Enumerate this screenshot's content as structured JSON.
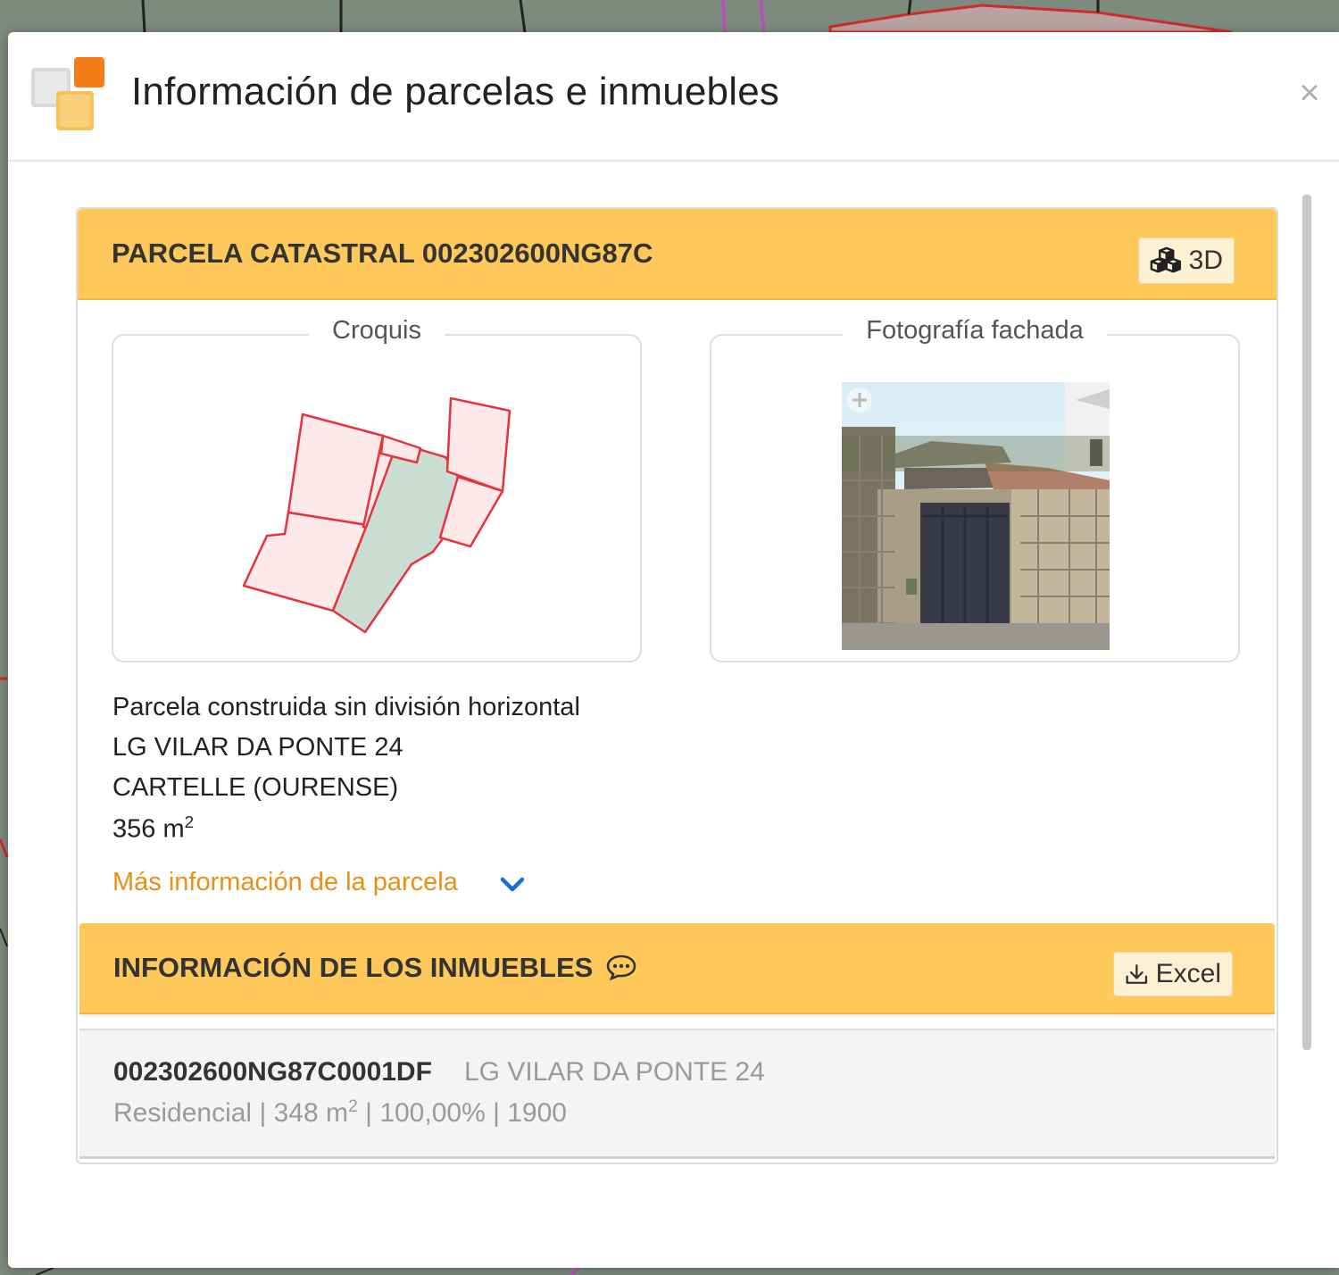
{
  "modal": {
    "title": "Información de parcelas e inmuebles",
    "close_label": "×"
  },
  "parcel": {
    "heading": "PARCELA CATASTRAL 002302600NG87C",
    "btn_3d_label": "3D",
    "sketch_legend": "Croquis",
    "photo_legend": "Fotografía fachada",
    "type": "Parcela construida sin división horizontal",
    "address": "LG VILAR DA PONTE 24",
    "municipality": "CARTELLE (OURENSE)",
    "area_value": "356 m",
    "area_exp": "2",
    "more_info_link": "Más información de la parcela"
  },
  "properties": {
    "heading": "INFORMACIÓN DE LOS INMUEBLES",
    "excel_label": "Excel",
    "items": [
      {
        "ref": "002302600NG87C0001DF",
        "address": "LG VILAR DA PONTE 24",
        "use": "Residencial",
        "sep": "|",
        "area": "348 m",
        "area_exp": "2",
        "share": "100,00%",
        "year": "1900"
      }
    ]
  },
  "colors": {
    "section_bar": "#fec85b",
    "link": "#e98e17",
    "chevron": "#1a6fd6",
    "parcel_outline": "#e8323c",
    "parcel_fill": "#fde9ea",
    "parcel_built_fill": "#c9ddd3"
  },
  "icons": [
    "app-logo",
    "close-icon",
    "cubes-icon",
    "chat-icon",
    "download-icon",
    "chevron-down-icon",
    "zoom-plus-icon"
  ]
}
